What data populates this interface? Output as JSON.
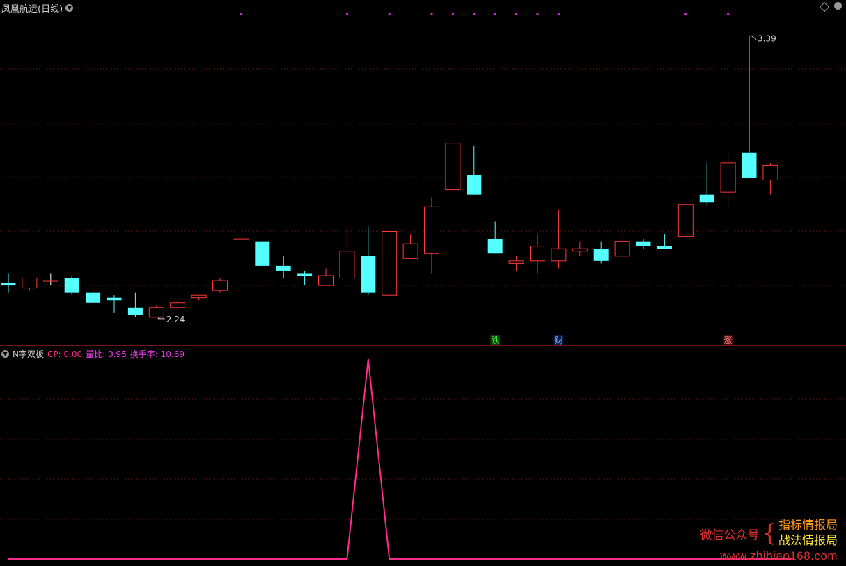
{
  "main_title": "凤凰航运(日线)",
  "sub_title": {
    "name": "N字双板",
    "cp": "CP: 0.00",
    "liangbi": "量比: 0.95",
    "huanshou": "换手率: 10.69"
  },
  "markers": {
    "die": "跌",
    "cai": "财",
    "zhang": "涨"
  },
  "price_labels": {
    "high": "3.39",
    "low": "2.24"
  },
  "watermark": {
    "left": "微信公众号",
    "right_top": "指标情报局",
    "right_bottom": "战法情报局",
    "url": "www.zhibiao168.com"
  },
  "colors": {
    "up": "#ff3a3a",
    "down": "#54ffff",
    "grid": "#7a1a1a",
    "line": "#ff2c8c",
    "dot": "#e020e0"
  },
  "chart_data": [
    {
      "type": "candlestick",
      "title": "凤凰航运(日线)",
      "candles": [
        {
          "o": 2.38,
          "h": 2.42,
          "l": 2.34,
          "c": 2.37
        },
        {
          "o": 2.36,
          "h": 2.4,
          "l": 2.35,
          "c": 2.4
        },
        {
          "o": 2.39,
          "h": 2.42,
          "l": 2.37,
          "c": 2.39
        },
        {
          "o": 2.4,
          "h": 2.41,
          "l": 2.33,
          "c": 2.34
        },
        {
          "o": 2.34,
          "h": 2.35,
          "l": 2.29,
          "c": 2.3
        },
        {
          "o": 2.32,
          "h": 2.33,
          "l": 2.26,
          "c": 2.31
        },
        {
          "o": 2.28,
          "h": 2.34,
          "l": 2.24,
          "c": 2.25
        },
        {
          "o": 2.24,
          "h": 2.29,
          "l": 2.24,
          "c": 2.28
        },
        {
          "o": 2.28,
          "h": 2.31,
          "l": 2.27,
          "c": 2.3
        },
        {
          "o": 2.32,
          "h": 2.33,
          "l": 2.31,
          "c": 2.33
        },
        {
          "o": 2.35,
          "h": 2.4,
          "l": 2.34,
          "c": 2.39
        },
        {
          "o": 2.56,
          "h": 2.56,
          "l": 2.56,
          "c": 2.56
        },
        {
          "o": 2.55,
          "h": 2.55,
          "l": 2.45,
          "c": 2.45
        },
        {
          "o": 2.45,
          "h": 2.49,
          "l": 2.4,
          "c": 2.43
        },
        {
          "o": 2.42,
          "h": 2.43,
          "l": 2.37,
          "c": 2.41
        },
        {
          "o": 2.37,
          "h": 2.44,
          "l": 2.37,
          "c": 2.41
        },
        {
          "o": 2.4,
          "h": 2.61,
          "l": 2.4,
          "c": 2.51
        },
        {
          "o": 2.49,
          "h": 2.61,
          "l": 2.33,
          "c": 2.34
        },
        {
          "o": 2.33,
          "h": 2.59,
          "l": 2.33,
          "c": 2.59
        },
        {
          "o": 2.48,
          "h": 2.58,
          "l": 2.48,
          "c": 2.54
        },
        {
          "o": 2.5,
          "h": 2.73,
          "l": 2.42,
          "c": 2.69
        },
        {
          "o": 2.76,
          "h": 2.95,
          "l": 2.76,
          "c": 2.95
        },
        {
          "o": 2.82,
          "h": 2.94,
          "l": 2.82,
          "c": 2.74
        },
        {
          "o": 2.56,
          "h": 2.63,
          "l": 2.5,
          "c": 2.5
        },
        {
          "o": 2.46,
          "h": 2.49,
          "l": 2.43,
          "c": 2.47
        },
        {
          "o": 2.47,
          "h": 2.58,
          "l": 2.42,
          "c": 2.53
        },
        {
          "o": 2.47,
          "h": 2.68,
          "l": 2.44,
          "c": 2.52
        },
        {
          "o": 2.51,
          "h": 2.55,
          "l": 2.49,
          "c": 2.52
        },
        {
          "o": 2.52,
          "h": 2.55,
          "l": 2.46,
          "c": 2.47
        },
        {
          "o": 2.49,
          "h": 2.58,
          "l": 2.48,
          "c": 2.55
        },
        {
          "o": 2.55,
          "h": 2.56,
          "l": 2.52,
          "c": 2.53
        },
        {
          "o": 2.53,
          "h": 2.58,
          "l": 2.52,
          "c": 2.52
        },
        {
          "o": 2.57,
          "h": 2.69,
          "l": 2.57,
          "c": 2.7
        },
        {
          "o": 2.74,
          "h": 2.87,
          "l": 2.7,
          "c": 2.71
        },
        {
          "o": 2.75,
          "h": 2.92,
          "l": 2.68,
          "c": 2.87
        },
        {
          "o": 2.91,
          "h": 3.39,
          "l": 2.91,
          "c": 2.81
        },
        {
          "o": 2.8,
          "h": 2.87,
          "l": 2.74,
          "c": 2.86
        }
      ],
      "price_range": [
        2.2,
        3.42
      ],
      "dots_at_candle_index": [
        11,
        16,
        18,
        20,
        21,
        22,
        23,
        24,
        25,
        26,
        32,
        34
      ],
      "grid": true
    },
    {
      "type": "line",
      "title": "N字双板",
      "series": [
        {
          "values": [
            0,
            0,
            0,
            0,
            0,
            0,
            0,
            0,
            0,
            0,
            0,
            0,
            0,
            0,
            0,
            0,
            0,
            1,
            0,
            0,
            0,
            0,
            0,
            0,
            0,
            0,
            0,
            0,
            0,
            0,
            0,
            0,
            0,
            0,
            0,
            0,
            0,
            0
          ]
        }
      ],
      "ylim": [
        0,
        1
      ],
      "grid": true
    }
  ]
}
